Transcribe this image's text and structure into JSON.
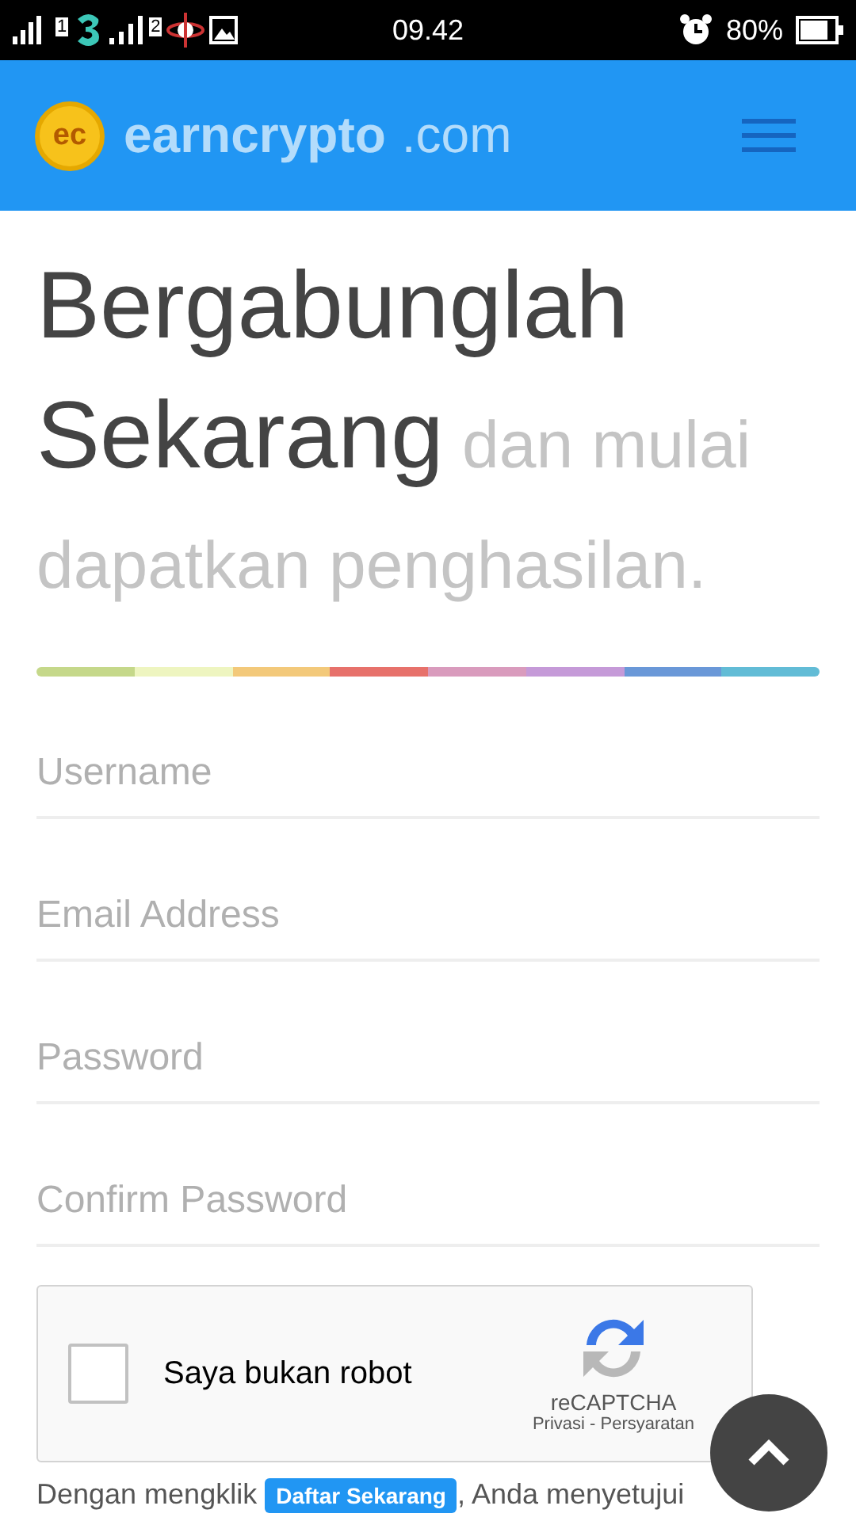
{
  "status_bar": {
    "sim_1": "1",
    "sim_2": "2",
    "time": "09.42",
    "battery": "80%"
  },
  "header": {
    "logo_badge": "ec",
    "brand": "earncrypto",
    "domain": ".com"
  },
  "headline": "**Bergabunglah Sekarang** dan mulai dapatkan penghasilan.",
  "fields": [
    {
      "placeholder": "Username"
    },
    {
      "placeholder": "Email Address"
    },
    {
      "placeholder": "Password"
    },
    {
      "placeholder": "Confirm Password"
    }
  ],
  "captcha": {
    "label": "Saya bukan robot",
    "checked": false,
    "brand": "reCAPTCHA",
    "links": "Privasi - Persyaratan"
  },
  "terms": {
    "before": "Dengan mengklik",
    "button": "Daftar Sekarang",
    "after": ", Anda menyetujui"
  }
}
